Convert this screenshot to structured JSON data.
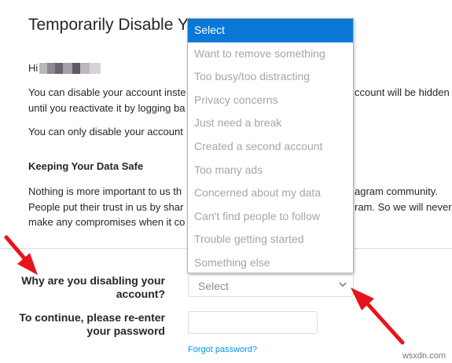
{
  "page": {
    "title": "Temporarily Disable Y",
    "greeting": "Hi",
    "para1_line1": "You can disable your account inste",
    "para1_line1_right": "ccount will be hidden",
    "para1_line2": "until you reactivate it by logging ba",
    "para2": "You can only disable your account",
    "heading": "Keeping Your Data Safe",
    "para3_line1": "Nothing is more important to us th",
    "para3_line1_right": "agram community.",
    "para3_line2": "People put their trust in us by shar",
    "para3_line2_right": "ram. So we will never",
    "para3_line3": "make any compromises when it co"
  },
  "form": {
    "reason_label": "Why are you disabling your account?",
    "reason_value": "Select",
    "password_label": "To continue, please re-enter your password",
    "password_value": "",
    "forgot_link": "Forgot password?"
  },
  "dropdown": {
    "options": [
      "Select",
      "Want to remove something",
      "Too busy/too distracting",
      "Privacy concerns",
      "Just need a break",
      "Created a second account",
      "Too many ads",
      "Concerned about my data",
      "Can't find people to follow",
      "Trouble getting started",
      "Something else"
    ],
    "selected": "Select"
  },
  "watermark": "wsxdn.com",
  "colors": {
    "highlight": "#0a78d7",
    "link": "#0095f6",
    "arrow": "#e8141b"
  }
}
